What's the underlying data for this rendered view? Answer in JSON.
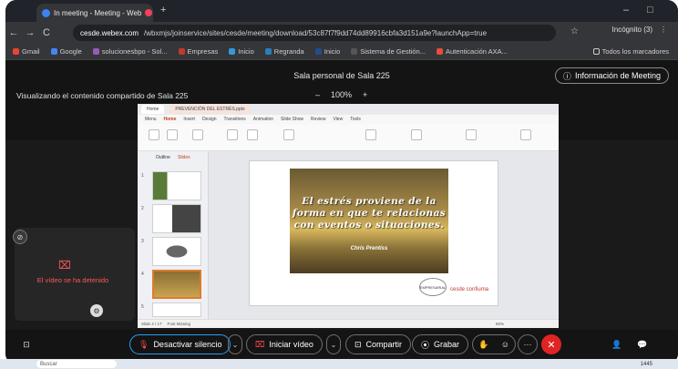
{
  "browser": {
    "tab_title": "In meeting - Meeting - Web",
    "close": "×",
    "new_tab": "+",
    "minimize": "–",
    "restore": "□",
    "back": "←",
    "forward": "→",
    "reload": "C",
    "url_host": "cesde.webex.com",
    "url_path": "/wbxmjs/joinservice/sites/cesde/meeting/download/53c87f7f9dd74dd89916cbfa3d151a9e?launchApp=true",
    "star": "☆",
    "incognito": "Incógnito (3)",
    "menu": "⋮",
    "bookmarks": [
      "Gmail",
      "Google",
      "solucionesbpo - Sol...",
      "Empresas",
      "Inicio",
      "Regranda",
      "Inicio",
      "Sistema de Gestión...",
      "Autenticación AXA..."
    ],
    "bookmarks_all": "Todos los marcadores",
    "accents": {
      "tab_rec": "#f43f5e",
      "tab_icon": "#3b82f6"
    }
  },
  "meeting": {
    "room": "Sala personal de Sala 225",
    "info_button": "Información de Meeting",
    "info_icon": "ⓘ",
    "viewing": "Visualizando el contenido compartido de Sala 225",
    "zoom_minus": "–",
    "zoom": "100%",
    "zoom_plus": "+",
    "video_off": "El vídeo se ha detenido",
    "pin_icon": "⊘",
    "video_off_icon": "⌧",
    "gear_icon": "⚙"
  },
  "presentation": {
    "tabs": [
      "Home",
      "PREVENCIÓN DEL ESTRÉS.pptx"
    ],
    "menu": [
      "Menu",
      "Home",
      "Insert",
      "Design",
      "Transitions",
      "Animation",
      "Slide Show",
      "Review",
      "View",
      "Tools"
    ],
    "active_menu": "Home",
    "outline_labels": [
      "Outline",
      "Slides"
    ],
    "slide_numbers": [
      "1",
      "2",
      "3",
      "4",
      "5"
    ],
    "quote": "El estrés proviene de la forma en que te relacionas con eventos o situaciones.",
    "author": "Chris Prentiss",
    "logo_text": "EMPRESARIAL",
    "brand": "cesde confiuma",
    "status": "Slide 4 / 17",
    "status2": "Font Missing",
    "zoom": "60%"
  },
  "controls": {
    "mute": "Desactivar silencio",
    "video": "Iniciar vídeo",
    "share": "Compartir",
    "record": "Grabar",
    "caret": "⌄",
    "reactions": "☺",
    "more": "⋯",
    "end": "✕",
    "participants": "👤",
    "chat": "💬",
    "captions": "⊡"
  },
  "taskbar": {
    "search": "Buscar",
    "time": "1445"
  }
}
